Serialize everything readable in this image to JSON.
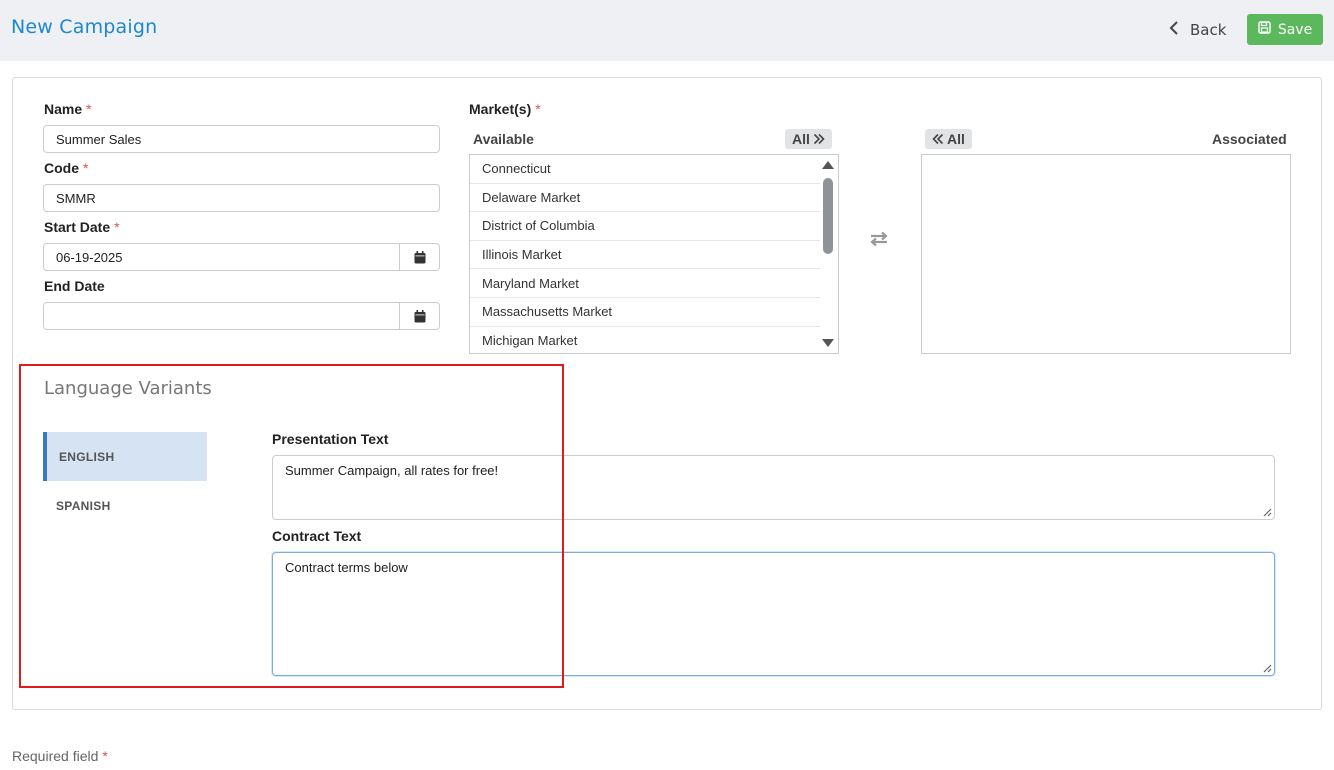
{
  "header": {
    "title": "New Campaign",
    "back_label": "Back",
    "save_label": "Save"
  },
  "form": {
    "name": {
      "label": "Name",
      "value": "Summer Sales",
      "required_mark": "*"
    },
    "code": {
      "label": "Code",
      "value": "SMMR",
      "required_mark": "*"
    },
    "start_date": {
      "label": "Start Date",
      "value": "06-19-2025",
      "required_mark": "*"
    },
    "end_date": {
      "label": "End Date",
      "value": ""
    }
  },
  "markets": {
    "label": "Market(s)",
    "required_mark": "*",
    "available_label": "Available",
    "associated_label": "Associated",
    "all_right_label": "All",
    "all_left_label": "All",
    "available_items": [
      "Connecticut",
      "Delaware Market",
      "District of Columbia",
      "Illinois Market",
      "Maryland Market",
      "Massachusetts Market",
      "Michigan Market"
    ],
    "associated_items": []
  },
  "language_variants": {
    "title": "Language Variants",
    "tabs": [
      {
        "label": "ENGLISH",
        "active": true
      },
      {
        "label": "SPANISH",
        "active": false
      }
    ],
    "presentation_label": "Presentation Text",
    "presentation_value": "Summer Campaign, all rates for free!",
    "contract_label": "Contract Text",
    "contract_value": "Contract terms below"
  },
  "footer": {
    "required_note": "Required field",
    "required_mark": "*"
  },
  "colors": {
    "title_blue": "#1e88c8",
    "save_green": "#5cb85c",
    "required_red": "#d9534f",
    "active_tab_bg": "#d5e3f2",
    "highlight_red": "#e01b1b"
  },
  "icons": {
    "back": "chevron-left-icon",
    "save": "floppy-disk-icon",
    "calendar": "calendar-icon",
    "swap": "swap-arrows-icon"
  }
}
